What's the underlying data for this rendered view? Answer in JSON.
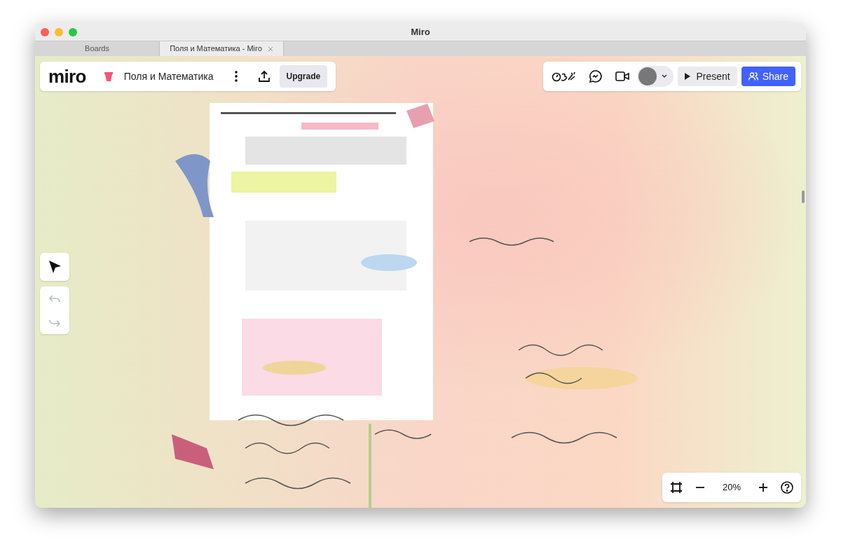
{
  "window": {
    "title": "Miro"
  },
  "tabs": [
    {
      "label": "Boards",
      "selected": false,
      "closable": false
    },
    {
      "label": "Поля и Математика - Miro",
      "selected": true,
      "closable": true
    }
  ],
  "board_bar": {
    "logo": "miro",
    "board_name": "Поля и Математика",
    "upgrade": "Upgrade"
  },
  "tool_bar": {
    "tools": [
      {
        "kind": "select",
        "selected": true
      }
    ],
    "history": [
      {
        "kind": "undo",
        "disabled": true
      },
      {
        "kind": "redo",
        "disabled": true
      }
    ]
  },
  "collab_bar": {
    "present": "Present",
    "share": "Share"
  },
  "zoom_bar": {
    "zoom": "20%"
  }
}
